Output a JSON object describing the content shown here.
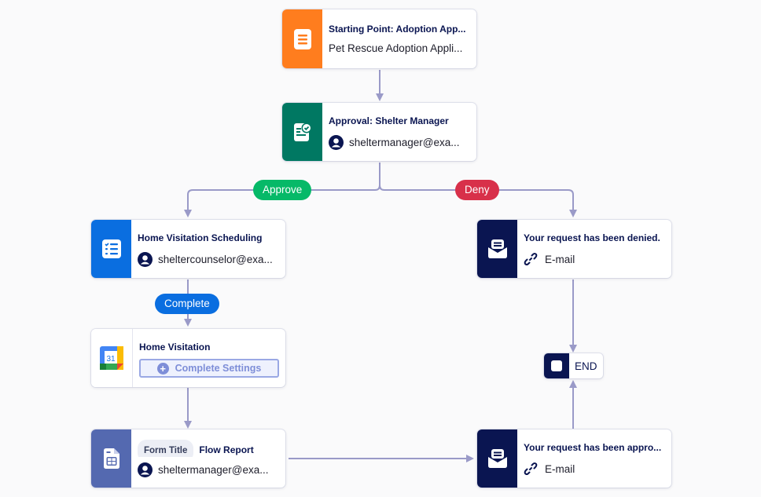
{
  "colors": {
    "connector": "#9a9ac8",
    "approve": "#06b968",
    "deny": "#d8304a",
    "complete": "#0a6ee0",
    "start": "#ff7d1e",
    "approval": "#007862",
    "task": "#0a6ee0",
    "email": "#0a1551",
    "calendar_side": "#ffffff",
    "report": "#5469b0",
    "end": "#0a1551"
  },
  "nodes": {
    "start": {
      "title": "Starting Point: Adoption App...",
      "subtitle": "Pet Rescue Adoption Appli...",
      "icon": "form-icon"
    },
    "approval": {
      "title": "Approval: Shelter Manager",
      "assignee": "sheltermanager@exa...",
      "icon": "approval-icon"
    },
    "scheduling": {
      "title": "Home Visitation Scheduling",
      "assignee": "sheltercounselor@exa...",
      "icon": "task-list-icon"
    },
    "denied_email": {
      "title": "Your request has been denied.",
      "channel": "E-mail",
      "icon": "email-icon"
    },
    "home_visitation": {
      "title": "Home Visitation",
      "button": "Complete Settings",
      "calendar_day": "31",
      "icon": "google-calendar-icon"
    },
    "flow_report": {
      "badge": "Form Title",
      "title": "Flow Report",
      "assignee": "sheltermanager@exa...",
      "icon": "report-icon"
    },
    "approved_email": {
      "title": "Your request has been appro...",
      "channel": "E-mail",
      "icon": "email-icon"
    },
    "end": {
      "label": "END"
    }
  },
  "branches": {
    "approve": "Approve",
    "deny": "Deny",
    "complete": "Complete"
  }
}
